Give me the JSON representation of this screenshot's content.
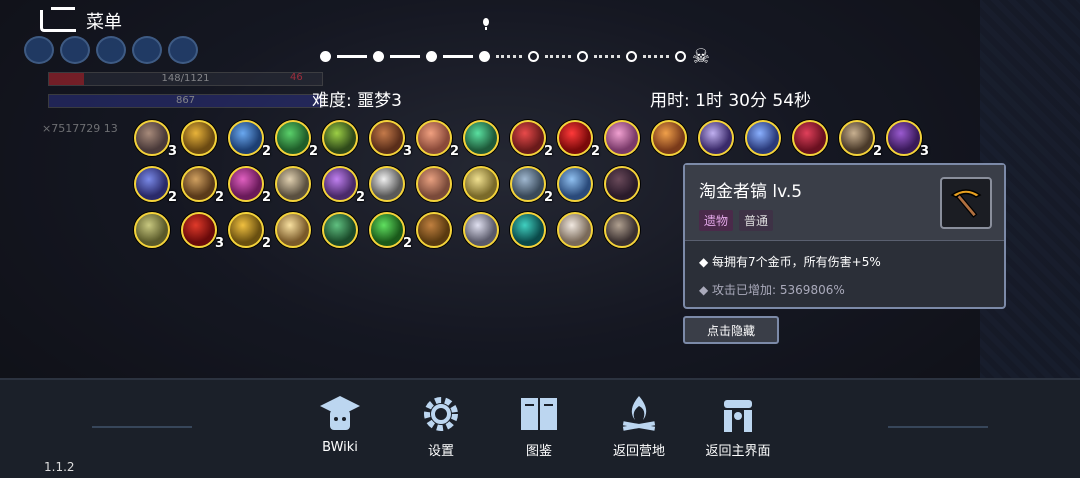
{
  "menu": {
    "label": "菜单"
  },
  "hud": {
    "hp_text": "148/1121",
    "hp_badge": "46",
    "mp_text": "867",
    "gold_text": "×7517729",
    "extra": "13"
  },
  "difficulty": "难度: 噩梦3",
  "time": "用时: 1时 30分 54秒",
  "relics": [
    [
      {
        "name": "plague-mask",
        "count": "3",
        "c1": "#4a3a3a",
        "c2": "#a78a7a"
      },
      {
        "name": "golden-goblet",
        "count": "",
        "c1": "#6b4a12",
        "c2": "#e8b33a"
      },
      {
        "name": "blue-ring",
        "count": "2",
        "c1": "#1d3f73",
        "c2": "#6aa8f0"
      },
      {
        "name": "clover",
        "count": "2",
        "c1": "#1f5e2a",
        "c2": "#5ad06a"
      },
      {
        "name": "green-worm",
        "count": "",
        "c1": "#2f4a1a",
        "c2": "#9ccf45"
      },
      {
        "name": "bandage-arm",
        "count": "3",
        "c1": "#5a2e1a",
        "c2": "#c47a4a"
      },
      {
        "name": "pink-creature",
        "count": "2",
        "c1": "#8a4a3a",
        "c2": "#f0a080"
      },
      {
        "name": "green-leaf",
        "count": "",
        "c1": "#1e5a3a",
        "c2": "#5ae0a0"
      },
      {
        "name": "red-eye-gem",
        "count": "2",
        "c1": "#6a1a1a",
        "c2": "#e84a4a"
      },
      {
        "name": "red-orb",
        "count": "2",
        "c1": "#7a0a0a",
        "c2": "#ff3a3a"
      },
      {
        "name": "brain",
        "count": "",
        "c1": "#7a3a6a",
        "c2": "#f0a0d0"
      },
      {
        "name": "scroll-card",
        "count": "",
        "c1": "#7a3a1a",
        "c2": "#f0a04a"
      },
      {
        "name": "purple-crystal",
        "count": "",
        "c1": "#3a2a6a",
        "c2": "#c0b0f0"
      },
      {
        "name": "blue-crown",
        "count": "",
        "c1": "#2a3a7a",
        "c2": "#8ab0ff"
      },
      {
        "name": "red-serpent",
        "count": "",
        "c1": "#6a1020",
        "c2": "#e0405a"
      },
      {
        "name": "bone-chain",
        "count": "2",
        "c1": "#4a3a2a",
        "c2": "#c8b090"
      },
      {
        "name": "purple-robe",
        "count": "3",
        "c1": "#3a1a5a",
        "c2": "#9a5ad0"
      }
    ],
    [
      {
        "name": "blue-gauntlet",
        "count": "2",
        "c1": "#2a2a6a",
        "c2": "#7a8ae8"
      },
      {
        "name": "hourglass",
        "count": "2",
        "c1": "#5a3a1a",
        "c2": "#d0a060"
      },
      {
        "name": "pink-demon",
        "count": "2",
        "c1": "#6a1a5a",
        "c2": "#e060c0"
      },
      {
        "name": "goggles",
        "count": "",
        "c1": "#5a5040",
        "c2": "#e0d0b0"
      },
      {
        "name": "purple-star",
        "count": "2",
        "c1": "#4a2a6a",
        "c2": "#c080f0"
      },
      {
        "name": "white-wings",
        "count": "",
        "c1": "#5a5a5a",
        "c2": "#f0f0f0"
      },
      {
        "name": "egg",
        "count": "",
        "c1": "#7a4a3a",
        "c2": "#e8a080"
      },
      {
        "name": "bread",
        "count": "",
        "c1": "#7a6a2a",
        "c2": "#f0e090"
      },
      {
        "name": "stone-shard",
        "count": "2",
        "c1": "#3a4a5a",
        "c2": "#a0b8d0"
      },
      {
        "name": "blue-lotus",
        "count": "",
        "c1": "#2a4a7a",
        "c2": "#90c0f0"
      },
      {
        "name": "dark-hat",
        "count": "",
        "c1": "#2a1a2a",
        "c2": "#6a4a5a"
      }
    ],
    [
      {
        "name": "jade-cube",
        "count": "",
        "c1": "#5a5a2a",
        "c2": "#c8c880"
      },
      {
        "name": "red-oni",
        "count": "3",
        "c1": "#6a0a0a",
        "c2": "#e03a2a"
      },
      {
        "name": "gold-antlers",
        "count": "2",
        "c1": "#6a5010",
        "c2": "#f0c040"
      },
      {
        "name": "candy-corn",
        "count": "",
        "c1": "#7a5a2a",
        "c2": "#f8e0a0"
      },
      {
        "name": "green-ufo",
        "count": "",
        "c1": "#1a4a2a",
        "c2": "#60c080"
      },
      {
        "name": "green-flame",
        "count": "2",
        "c1": "#1a5a1a",
        "c2": "#60e060"
      },
      {
        "name": "treasure-chest",
        "count": "",
        "c1": "#5a3a10",
        "c2": "#c08040"
      },
      {
        "name": "white-flower",
        "count": "",
        "c1": "#5a5a6a",
        "c2": "#e0e0f0"
      },
      {
        "name": "teal-shell",
        "count": "",
        "c1": "#0a4a4a",
        "c2": "#40d0c0"
      },
      {
        "name": "feather",
        "count": "",
        "c1": "#7a6a5a",
        "c2": "#f0e8e0"
      },
      {
        "name": "bone-bow",
        "count": "",
        "c1": "#3a3030",
        "c2": "#b0a090"
      }
    ]
  ],
  "tooltip": {
    "title": "淘金者镐 lv.5",
    "tag1": "遗物",
    "tag2": "普通",
    "desc1": "每拥有7个金币，所有伤害+5%",
    "desc2": "攻击已增加: 5369806%",
    "hide_btn": "点击隐藏"
  },
  "nav": [
    {
      "label": "BWiki",
      "icon": "bwiki-icon"
    },
    {
      "label": "设置",
      "icon": "settings-gear-icon"
    },
    {
      "label": "图鉴",
      "icon": "codex-book-icon"
    },
    {
      "label": "返回营地",
      "icon": "campfire-icon"
    },
    {
      "label": "返回主界面",
      "icon": "main-menu-icon"
    }
  ],
  "version": "1.1.2",
  "colors": {
    "accent_border": "#f4d33a",
    "panel_border": "#7c8aa8",
    "tag_purple": "#e3a7e8"
  }
}
